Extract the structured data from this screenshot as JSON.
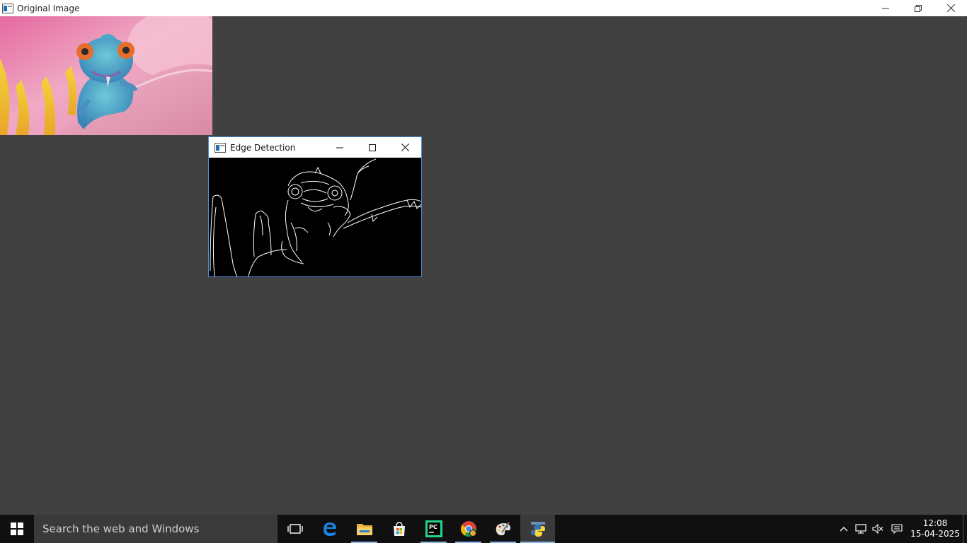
{
  "main_window": {
    "title": "Original Image"
  },
  "edge_window": {
    "title": "Edge Detection"
  },
  "taskbar": {
    "search_placeholder": "Search the web and Windows",
    "apps": [
      {
        "icon": "task-view-icon"
      },
      {
        "icon": "edge-browser-icon"
      },
      {
        "icon": "file-explorer-icon"
      },
      {
        "icon": "store-icon"
      },
      {
        "icon": "pycharm-icon"
      },
      {
        "icon": "chrome-icon"
      },
      {
        "icon": "paint-icon"
      },
      {
        "icon": "python-icon"
      }
    ],
    "clock_time": "12:08",
    "clock_date": "15-04-2025"
  },
  "colors": {
    "desktop": "#414141",
    "taskbar": "#101010",
    "accent": "#4a90d9"
  }
}
